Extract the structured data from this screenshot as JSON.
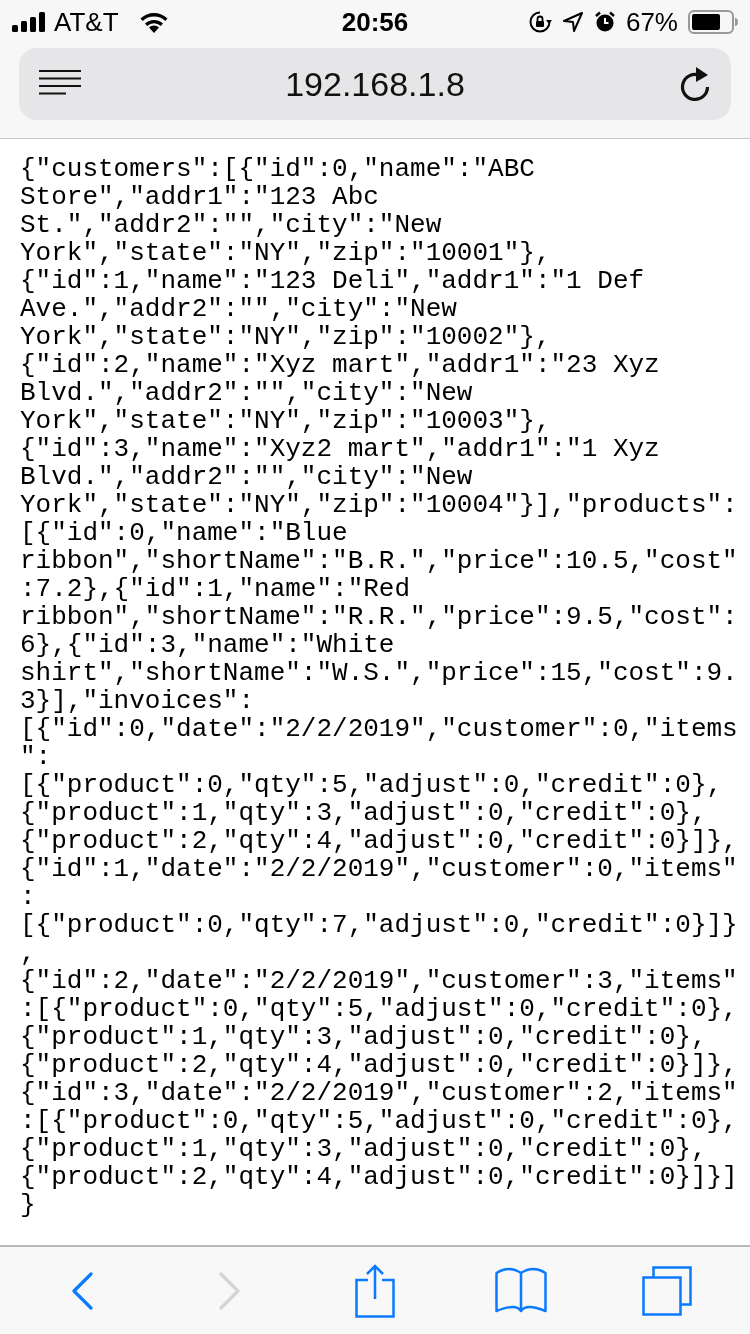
{
  "status_bar": {
    "carrier": "AT&T",
    "time": "20:56",
    "battery": "67%"
  },
  "address_bar": {
    "url": "192.168.1.8"
  },
  "page": {
    "lines": [
      "{\"customers\":[{\"id\":0,\"name\":\"ABC",
      "Store\",\"addr1\":\"123 Abc",
      "St.\",\"addr2\":\"\",\"city\":\"New",
      "York\",\"state\":\"NY\",\"zip\":\"10001\"},",
      "{\"id\":1,\"name\":\"123 Deli\",\"addr1\":\"1 Def",
      "Ave.\",\"addr2\":\"\",\"city\":\"New",
      "York\",\"state\":\"NY\",\"zip\":\"10002\"},",
      "{\"id\":2,\"name\":\"Xyz mart\",\"addr1\":\"23 Xyz",
      "Blvd.\",\"addr2\":\"\",\"city\":\"New",
      "York\",\"state\":\"NY\",\"zip\":\"10003\"},",
      "{\"id\":3,\"name\":\"Xyz2 mart\",\"addr1\":\"1 Xyz",
      "Blvd.\",\"addr2\":\"\",\"city\":\"New",
      "York\",\"state\":\"NY\",\"zip\":\"10004\"}],\"products\":",
      "[{\"id\":0,\"name\":\"Blue",
      "ribbon\",\"shortName\":\"B.R.\",\"price\":10.5,\"cost\"",
      ":7.2},{\"id\":1,\"name\":\"Red",
      "ribbon\",\"shortName\":\"R.R.\",\"price\":9.5,\"cost\":",
      "6},{\"id\":3,\"name\":\"White",
      "shirt\",\"shortName\":\"W.S.\",\"price\":15,\"cost\":9.",
      "3}],\"invoices\":",
      "[{\"id\":0,\"date\":\"2/2/2019\",\"customer\":0,\"items",
      "\":",
      "[{\"product\":0,\"qty\":5,\"adjust\":0,\"credit\":0},",
      "{\"product\":1,\"qty\":3,\"adjust\":0,\"credit\":0},",
      "{\"product\":2,\"qty\":4,\"adjust\":0,\"credit\":0}]},",
      "{\"id\":1,\"date\":\"2/2/2019\",\"customer\":0,\"items\"",
      ":",
      "[{\"product\":0,\"qty\":7,\"adjust\":0,\"credit\":0}]}",
      ",",
      "{\"id\":2,\"date\":\"2/2/2019\",\"customer\":3,\"items\"",
      ":[{\"product\":0,\"qty\":5,\"adjust\":0,\"credit\":0},",
      "{\"product\":1,\"qty\":3,\"adjust\":0,\"credit\":0},",
      "{\"product\":2,\"qty\":4,\"adjust\":0,\"credit\":0}]},",
      "{\"id\":3,\"date\":\"2/2/2019\",\"customer\":2,\"items\"",
      ":[{\"product\":0,\"qty\":5,\"adjust\":0,\"credit\":0},",
      "{\"product\":1,\"qty\":3,\"adjust\":0,\"credit\":0},",
      "{\"product\":2,\"qty\":4,\"adjust\":0,\"credit\":0}]}]",
      "}"
    ]
  },
  "toolbar": [
    {
      "kind": "back",
      "disabled": false
    },
    {
      "kind": "forward",
      "disabled": true
    },
    {
      "kind": "share",
      "disabled": false
    },
    {
      "kind": "bookmarks",
      "disabled": false
    },
    {
      "kind": "tabs",
      "disabled": false
    }
  ]
}
